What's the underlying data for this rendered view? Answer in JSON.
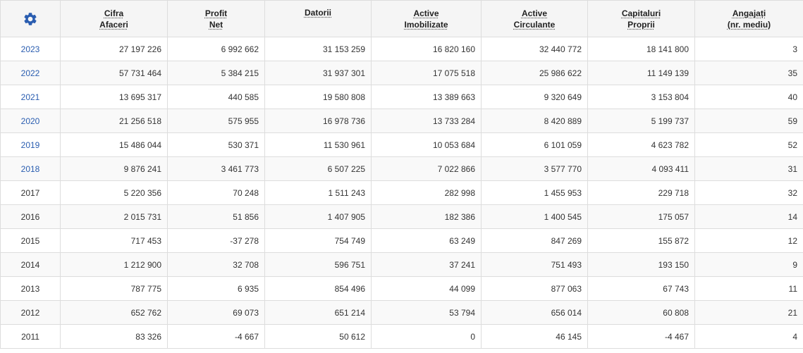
{
  "settings_icon": "gear-icon",
  "accent_color": "#2a5db0",
  "columns": [
    {
      "key": "cifra",
      "lines": [
        "Cifra",
        "Afaceri"
      ]
    },
    {
      "key": "profit",
      "lines": [
        "Profit",
        "Net"
      ]
    },
    {
      "key": "datorii",
      "lines": [
        "Datorii"
      ]
    },
    {
      "key": "active_imob",
      "lines": [
        "Active",
        "Imobilizate"
      ]
    },
    {
      "key": "active_circ",
      "lines": [
        "Active",
        "Circulante"
      ]
    },
    {
      "key": "capitaluri",
      "lines": [
        "Capitaluri",
        "Proprii"
      ]
    },
    {
      "key": "angajati",
      "lines": [
        "Angajați",
        "(nr. mediu)"
      ]
    }
  ],
  "rows": [
    {
      "year": "2023",
      "link": true,
      "values": [
        "27 197 226",
        "6 992 662",
        "31 153 259",
        "16 820 160",
        "32 440 772",
        "18 141 800",
        "3"
      ]
    },
    {
      "year": "2022",
      "link": true,
      "values": [
        "57 731 464",
        "5 384 215",
        "31 937 301",
        "17 075 518",
        "25 986 622",
        "11 149 139",
        "35"
      ]
    },
    {
      "year": "2021",
      "link": true,
      "values": [
        "13 695 317",
        "440 585",
        "19 580 808",
        "13 389 663",
        "9 320 649",
        "3 153 804",
        "40"
      ]
    },
    {
      "year": "2020",
      "link": true,
      "values": [
        "21 256 518",
        "575 955",
        "16 978 736",
        "13 733 284",
        "8 420 889",
        "5 199 737",
        "59"
      ]
    },
    {
      "year": "2019",
      "link": true,
      "values": [
        "15 486 044",
        "530 371",
        "11 530 961",
        "10 053 684",
        "6 101 059",
        "4 623 782",
        "52"
      ]
    },
    {
      "year": "2018",
      "link": true,
      "values": [
        "9 876 241",
        "3 461 773",
        "6 507 225",
        "7 022 866",
        "3 577 770",
        "4 093 411",
        "31"
      ]
    },
    {
      "year": "2017",
      "link": false,
      "values": [
        "5 220 356",
        "70 248",
        "1 511 243",
        "282 998",
        "1 455 953",
        "229 718",
        "32"
      ]
    },
    {
      "year": "2016",
      "link": false,
      "values": [
        "2 015 731",
        "51 856",
        "1 407 905",
        "182 386",
        "1 400 545",
        "175 057",
        "14"
      ]
    },
    {
      "year": "2015",
      "link": false,
      "values": [
        "717 453",
        "-37 278",
        "754 749",
        "63 249",
        "847 269",
        "155 872",
        "12"
      ]
    },
    {
      "year": "2014",
      "link": false,
      "values": [
        "1 212 900",
        "32 708",
        "596 751",
        "37 241",
        "751 493",
        "193 150",
        "9"
      ]
    },
    {
      "year": "2013",
      "link": false,
      "values": [
        "787 775",
        "6 935",
        "854 496",
        "44 099",
        "877 063",
        "67 743",
        "11"
      ]
    },
    {
      "year": "2012",
      "link": false,
      "values": [
        "652 762",
        "69 073",
        "651 214",
        "53 794",
        "656 014",
        "60 808",
        "21"
      ]
    },
    {
      "year": "2011",
      "link": false,
      "values": [
        "83 326",
        "-4 667",
        "50 612",
        "0",
        "46 145",
        "-4 467",
        "4"
      ]
    }
  ]
}
